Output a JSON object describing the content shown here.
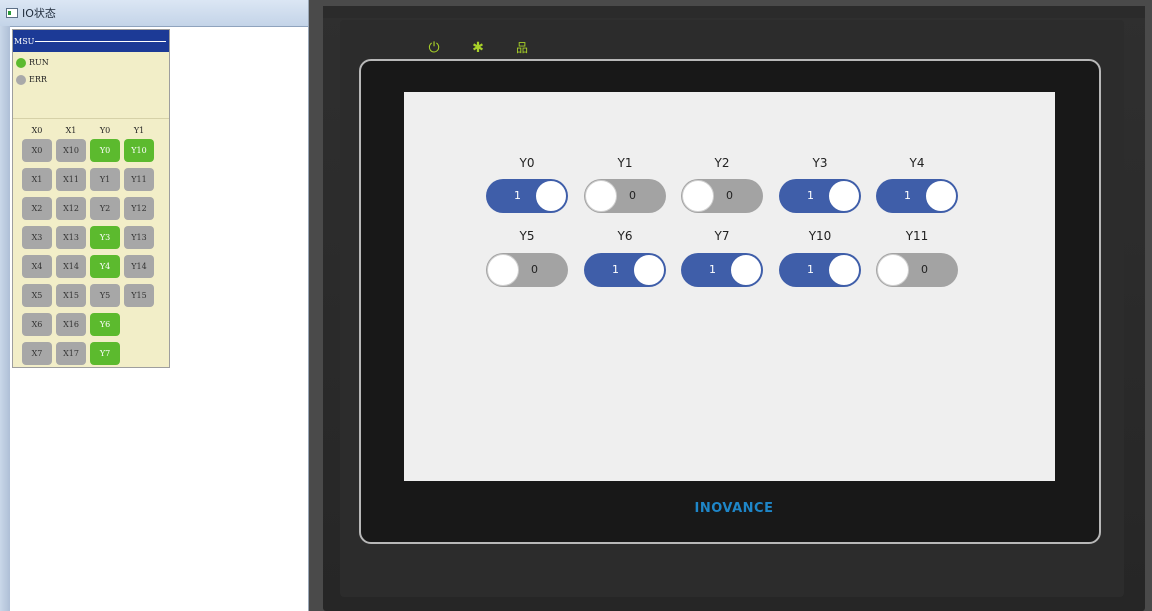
{
  "window": {
    "title": "IO状态"
  },
  "module": {
    "name": "MSU",
    "leds": [
      {
        "label": "RUN",
        "color": "#5cba2e"
      },
      {
        "label": "ERR",
        "color": "#a9a9a9"
      }
    ]
  },
  "io_table": {
    "headers": [
      "X0",
      "X1",
      "Y0",
      "Y1"
    ],
    "rows": [
      [
        {
          "label": "X0",
          "on": false
        },
        {
          "label": "X10",
          "on": false
        },
        {
          "label": "Y0",
          "on": true
        },
        {
          "label": "Y10",
          "on": true
        }
      ],
      [
        {
          "label": "X1",
          "on": false
        },
        {
          "label": "X11",
          "on": false
        },
        {
          "label": "Y1",
          "on": false
        },
        {
          "label": "Y11",
          "on": false
        }
      ],
      [
        {
          "label": "X2",
          "on": false
        },
        {
          "label": "X12",
          "on": false
        },
        {
          "label": "Y2",
          "on": false
        },
        {
          "label": "Y12",
          "on": false
        }
      ],
      [
        {
          "label": "X3",
          "on": false
        },
        {
          "label": "X13",
          "on": false
        },
        {
          "label": "Y3",
          "on": true
        },
        {
          "label": "Y13",
          "on": false
        }
      ],
      [
        {
          "label": "X4",
          "on": false
        },
        {
          "label": "X14",
          "on": false
        },
        {
          "label": "Y4",
          "on": true
        },
        {
          "label": "Y14",
          "on": false
        }
      ],
      [
        {
          "label": "X5",
          "on": false
        },
        {
          "label": "X15",
          "on": false
        },
        {
          "label": "Y5",
          "on": false
        },
        {
          "label": "Y15",
          "on": false
        }
      ],
      [
        {
          "label": "X6",
          "on": false
        },
        {
          "label": "X16",
          "on": false
        },
        {
          "label": "Y6",
          "on": true
        }
      ],
      [
        {
          "label": "X7",
          "on": false
        },
        {
          "label": "X17",
          "on": false
        },
        {
          "label": "Y7",
          "on": true
        }
      ]
    ]
  },
  "hmi": {
    "indicators": [
      {
        "icon": "power-icon",
        "glyph": "⏻"
      },
      {
        "icon": "sun-icon",
        "glyph": "✱"
      },
      {
        "icon": "network-icon",
        "glyph": "品"
      }
    ],
    "brand": "INOVANCE",
    "switches": [
      [
        {
          "label": "Y0",
          "value": "1",
          "on": true
        },
        {
          "label": "Y1",
          "value": "0",
          "on": false
        },
        {
          "label": "Y2",
          "value": "0",
          "on": false
        },
        {
          "label": "Y3",
          "value": "1",
          "on": true
        },
        {
          "label": "Y4",
          "value": "1",
          "on": true
        }
      ],
      [
        {
          "label": "Y5",
          "value": "0",
          "on": false
        },
        {
          "label": "Y6",
          "value": "1",
          "on": true
        },
        {
          "label": "Y7",
          "value": "1",
          "on": true
        },
        {
          "label": "Y10",
          "value": "1",
          "on": true
        },
        {
          "label": "Y11",
          "value": "0",
          "on": false
        }
      ]
    ]
  }
}
